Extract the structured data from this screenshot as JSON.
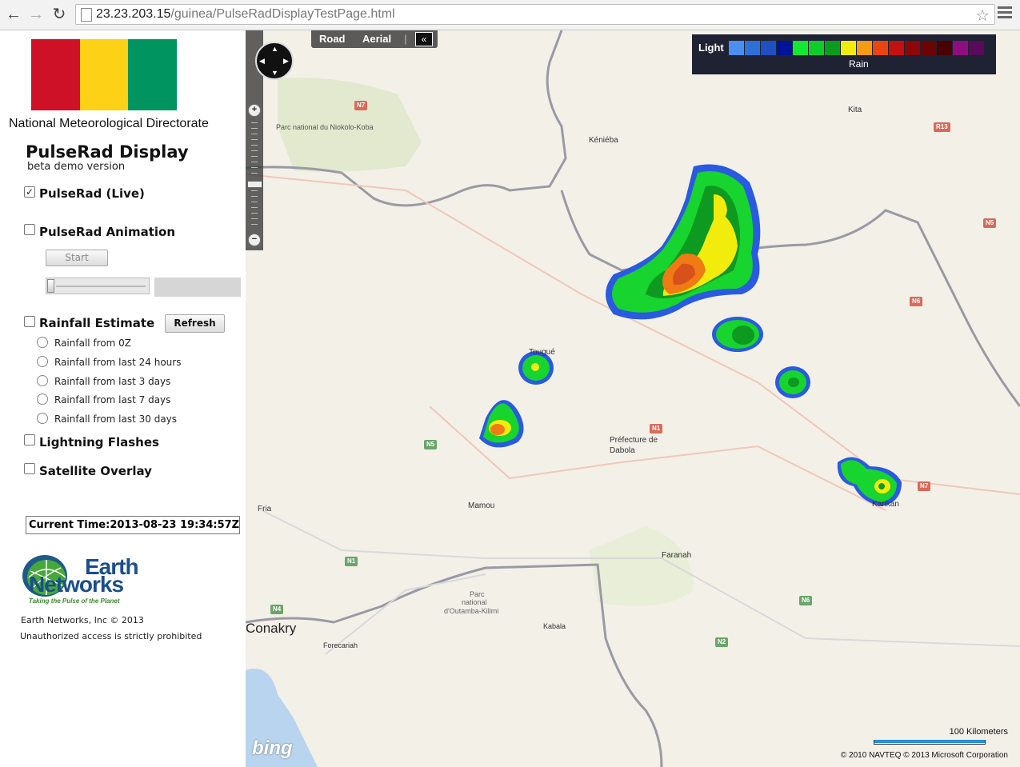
{
  "browser": {
    "url_host": "23.23.203.15",
    "url_path": "/guinea/PulseRadDisplayTestPage.html",
    "back_icon": "back-arrow-icon",
    "forward_icon": "forward-arrow-icon",
    "reload_icon": "reload-icon"
  },
  "flag_colors": [
    "#ce1126",
    "#fcd116",
    "#009460"
  ],
  "sidebar": {
    "org": "National Meteorological Directorate",
    "title": "PulseRad Display",
    "subtitle": "beta demo version",
    "live": {
      "label": "PulseRad (Live)",
      "checked": true
    },
    "animation": {
      "label": "PulseRad Animation",
      "checked": false,
      "start_label": "Start"
    },
    "rainfall": {
      "label": "Rainfall Estimate",
      "refresh_label": "Refresh",
      "options": [
        "Rainfall from 0Z",
        "Rainfall from last 24 hours",
        "Rainfall from last 3 days",
        "Rainfall from last 7 days",
        "Rainfall from last 30 days"
      ]
    },
    "lightning": {
      "label": "Lightning Flashes"
    },
    "satellite": {
      "label": "Satellite Overlay"
    },
    "current_time": "Current Time:2013-08-23 19:34:57Z",
    "logo_line1": "Earth",
    "logo_line2": "Networks",
    "logo_tagline": "Taking the Pulse of the Planet",
    "copyright": "Earth Networks, Inc © 2013",
    "warning": "Unauthorized access is strictly prohibited"
  },
  "map": {
    "road_label": "Road",
    "aerial_label": "Aerial",
    "collapse_label": "«",
    "legend_light": "Light",
    "legend_rain": "Rain",
    "legend_colors": [
      "#4a8ff0",
      "#2e6fd8",
      "#1f4fc0",
      "#00139a",
      "#13e832",
      "#0ecc2a",
      "#0b9c1c",
      "#f2ec0c",
      "#f79a14",
      "#e84510",
      "#c41010",
      "#8c0808",
      "#6c0404",
      "#4a0000",
      "#8e0e80",
      "#5a0a5a"
    ],
    "places": [
      "Parc national du Niokolo-Koba",
      "Kéniéba",
      "Kita",
      "Tougué",
      "Préfecture de",
      "Dabola",
      "Fria",
      "Mamou",
      "Faranah",
      "Kankan",
      "Conakry",
      "Forecariah",
      "Kabala",
      "Parc",
      "national",
      "d'Outamba-Kilimi"
    ],
    "roads": [
      "N7",
      "R13",
      "N5",
      "N6",
      "N1",
      "N5",
      "N7",
      "N1",
      "N4",
      "N6",
      "N2"
    ],
    "scale_label": "100 Kilometers",
    "bing_label": "bing",
    "copyright": "© 2010 NAVTEQ   © 2013 Microsoft Corporation"
  }
}
